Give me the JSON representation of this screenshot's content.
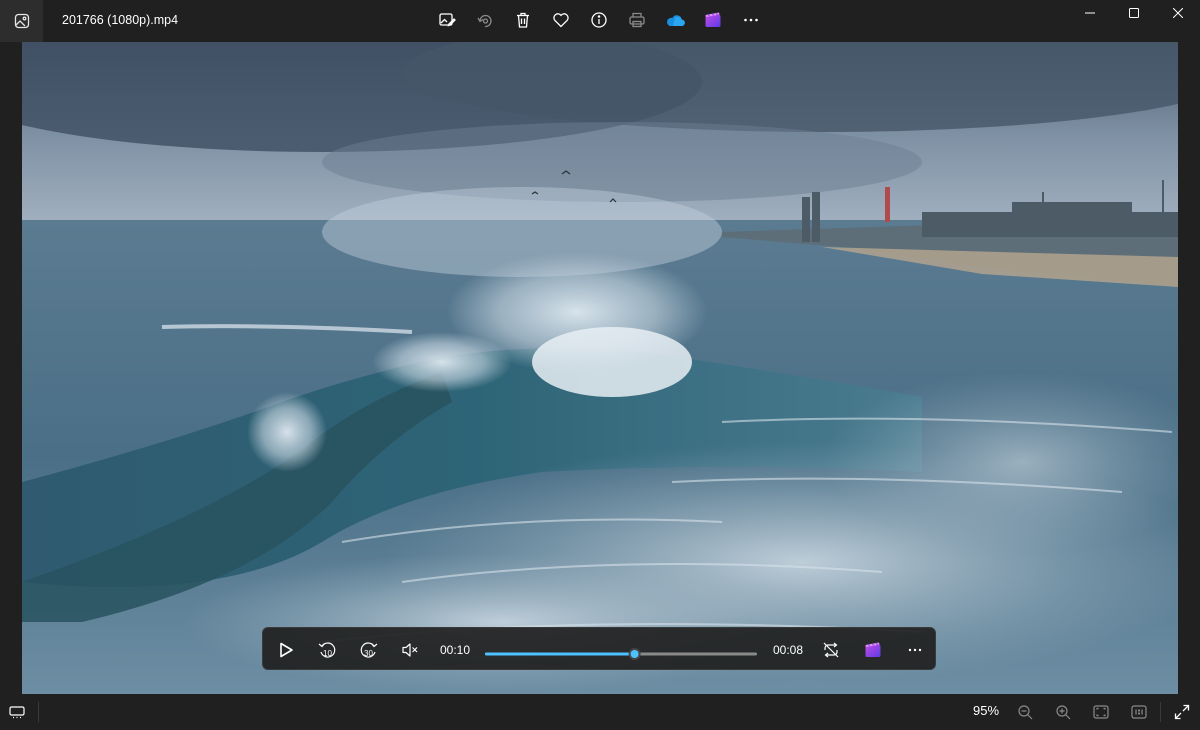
{
  "window": {
    "title": "201766 (1080p).mp4"
  },
  "toolbar": {
    "items": [
      {
        "name": "edit-image-icon"
      },
      {
        "name": "rotate-icon"
      },
      {
        "name": "delete-icon"
      },
      {
        "name": "favorite-icon"
      },
      {
        "name": "info-icon"
      },
      {
        "name": "print-icon"
      },
      {
        "name": "onedrive-icon"
      },
      {
        "name": "clipchamp-icon"
      },
      {
        "name": "more-icon"
      }
    ]
  },
  "player": {
    "current_time": "00:10",
    "remaining_time": "00:08",
    "progress": 0.55,
    "skip_back_label": "10",
    "skip_forward_label": "30",
    "accent_color": "#4cc2ff"
  },
  "statusbar": {
    "zoom_level": "95%"
  }
}
